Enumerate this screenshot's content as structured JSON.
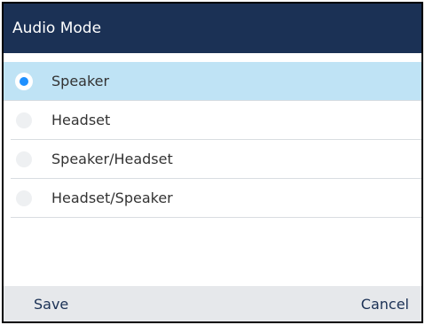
{
  "header": {
    "title": "Audio Mode"
  },
  "options": [
    {
      "label": "Speaker",
      "selected": true
    },
    {
      "label": "Headset",
      "selected": false
    },
    {
      "label": "Speaker/Headset",
      "selected": false
    },
    {
      "label": "Headset/Speaker",
      "selected": false
    }
  ],
  "footer": {
    "save_label": "Save",
    "cancel_label": "Cancel"
  },
  "colors": {
    "header_bg": "#1b3155",
    "selected_bg": "#bfe3f5",
    "radio_dot": "#1e90ff"
  }
}
